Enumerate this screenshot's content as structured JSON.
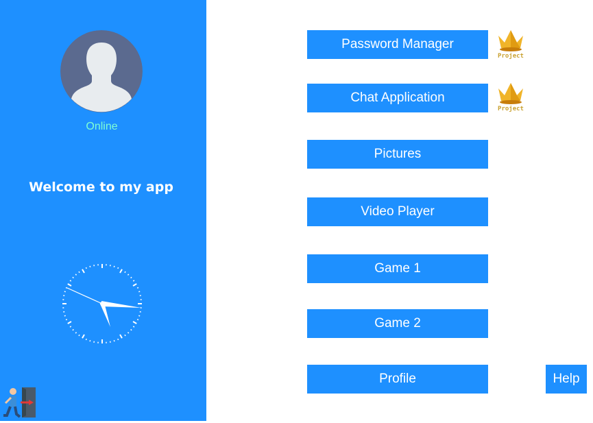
{
  "sidebar": {
    "status": "Online",
    "welcome": "Welcome to my app"
  },
  "menu": {
    "items": [
      {
        "label": "Password Manager",
        "badge": "Project"
      },
      {
        "label": "Chat Application",
        "badge": "Project"
      },
      {
        "label": "Pictures"
      },
      {
        "label": "Video Player"
      },
      {
        "label": "Game 1"
      },
      {
        "label": "Game 2"
      },
      {
        "label": "Profile"
      }
    ]
  },
  "help_label": "Help",
  "icons": {
    "avatar": "user-silhouette-icon",
    "clock": "analog-clock-icon",
    "exit": "exit-door-icon",
    "badge": "crown-icon"
  },
  "colors": {
    "accent": "#1e90ff",
    "status": "#7fffd4",
    "avatar_bg": "#5b6a8f",
    "crown": "#f0b429"
  }
}
